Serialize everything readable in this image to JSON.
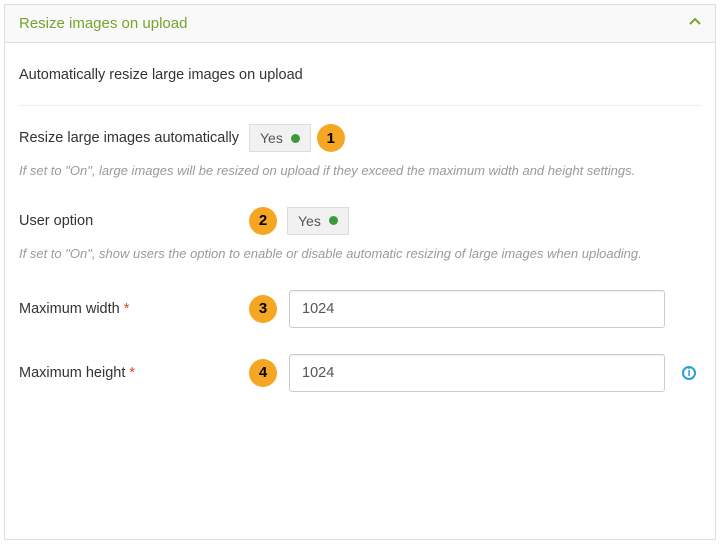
{
  "panel": {
    "title": "Resize images on upload",
    "description": "Automatically resize large images on upload"
  },
  "fields": {
    "resize_auto": {
      "label": "Resize large images automatically",
      "value": "Yes",
      "help": "If set to \"On\", large images will be resized on upload if they exceed the maximum width and height settings.",
      "badge": "1"
    },
    "user_option": {
      "label": "User option",
      "value": "Yes",
      "help": "If set to \"On\", show users the option to enable or disable automatic resizing of large images when uploading.",
      "badge": "2"
    },
    "max_width": {
      "label": "Maximum width",
      "value": "1024",
      "badge": "3"
    },
    "max_height": {
      "label": "Maximum height",
      "value": "1024",
      "badge": "4"
    }
  },
  "required_marker": "*"
}
